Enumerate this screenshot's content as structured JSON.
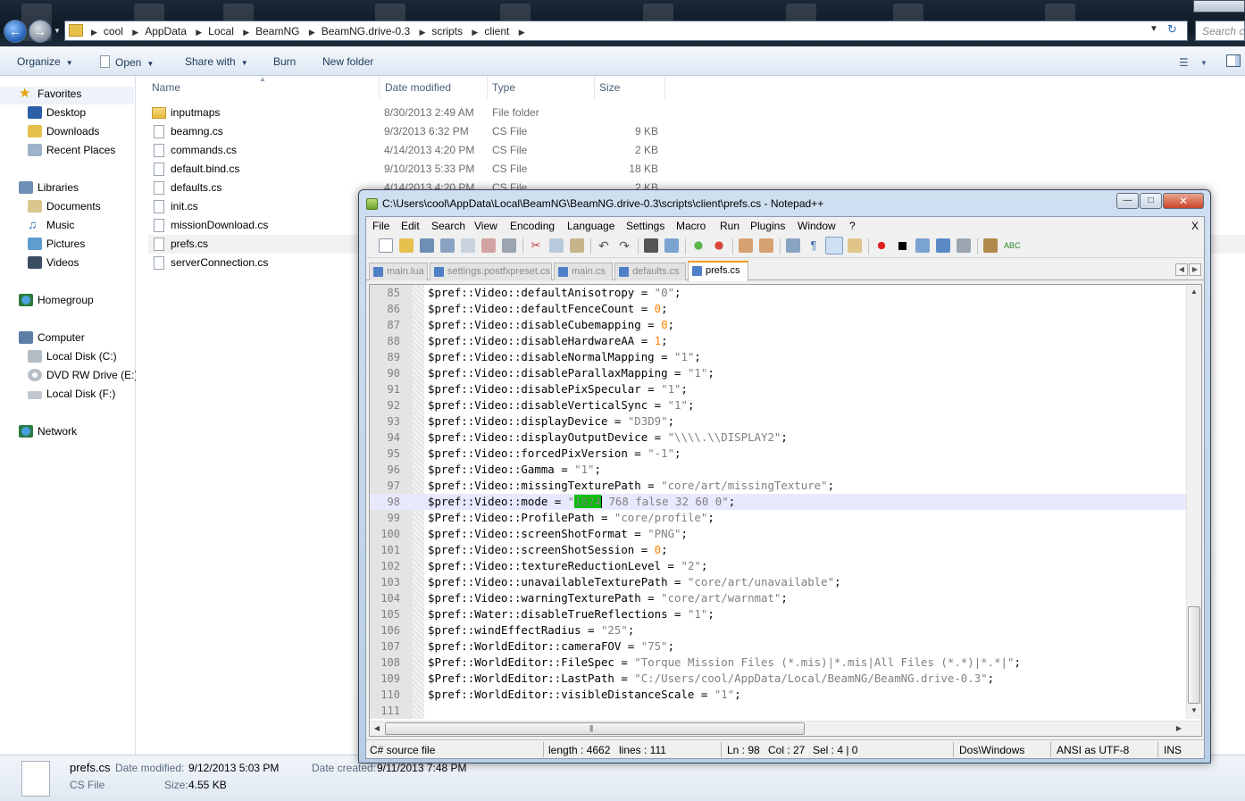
{
  "explorer": {
    "breadcrumbs": [
      "cool",
      "AppData",
      "Local",
      "BeamNG",
      "BeamNG.drive-0.3",
      "scripts",
      "client"
    ],
    "search_placeholder": "Search cl",
    "commands": {
      "organize": "Organize",
      "open": "Open",
      "share_with": "Share with",
      "burn": "Burn",
      "new_folder": "New folder"
    },
    "nav": {
      "favorites": "Favorites",
      "desktop": "Desktop",
      "downloads": "Downloads",
      "recent_places": "Recent Places",
      "libraries": "Libraries",
      "documents": "Documents",
      "music": "Music",
      "pictures": "Pictures",
      "videos": "Videos",
      "homegroup": "Homegroup",
      "computer": "Computer",
      "local_disk_c": "Local Disk (C:)",
      "dvd_drive": "DVD RW Drive (E:)",
      "local_disk_f": "Local Disk (F:)",
      "network": "Network"
    },
    "columns": {
      "name": "Name",
      "date_modified": "Date modified",
      "type": "Type",
      "size": "Size"
    },
    "files": [
      {
        "name": "inputmaps",
        "date": "8/30/2013 2:49 AM",
        "type": "File folder",
        "size": ""
      },
      {
        "name": "beamng.cs",
        "date": "9/3/2013 6:32 PM",
        "type": "CS File",
        "size": "9 KB"
      },
      {
        "name": "commands.cs",
        "date": "4/14/2013 4:20 PM",
        "type": "CS File",
        "size": "2 KB"
      },
      {
        "name": "default.bind.cs",
        "date": "9/10/2013 5:33 PM",
        "type": "CS File",
        "size": "18 KB"
      },
      {
        "name": "defaults.cs",
        "date": "4/14/2013 4:20 PM",
        "type": "CS File",
        "size": "2 KB"
      },
      {
        "name": "init.cs",
        "date": "",
        "type": "",
        "size": ""
      },
      {
        "name": "missionDownload.cs",
        "date": "",
        "type": "",
        "size": ""
      },
      {
        "name": "prefs.cs",
        "date": "",
        "type": "",
        "size": ""
      },
      {
        "name": "serverConnection.cs",
        "date": "",
        "type": "",
        "size": ""
      }
    ],
    "details": {
      "filename": "prefs.cs",
      "filetype": "CS File",
      "date_modified_label": "Date modified:",
      "date_modified": "9/12/2013 5:03 PM",
      "size_label": "Size:",
      "size": "4.55 KB",
      "date_created_label": "Date created:",
      "date_created": "9/11/2013 7:48 PM"
    }
  },
  "notepad": {
    "title": "C:\\Users\\cool\\AppData\\Local\\BeamNG\\BeamNG.drive-0.3\\scripts\\client\\prefs.cs - Notepad++",
    "menu": [
      "File",
      "Edit",
      "Search",
      "View",
      "Encoding",
      "Language",
      "Settings",
      "Macro",
      "Run",
      "Plugins",
      "Window",
      "?"
    ],
    "menu_close": "X",
    "tabs": [
      "main.lua",
      "settings.postfxpreset.cs",
      "main.cs",
      "defaults.cs",
      "prefs.cs"
    ],
    "active_tab": "prefs.cs",
    "lines": [
      {
        "n": "85",
        "var": "$pref::Video::defaultAnisotropy",
        "val": "\"0\"",
        "kind": "str"
      },
      {
        "n": "86",
        "var": "$pref::Video::defaultFenceCount",
        "val": "0",
        "kind": "num"
      },
      {
        "n": "87",
        "var": "$pref::Video::disableCubemapping",
        "val": "0",
        "kind": "num"
      },
      {
        "n": "88",
        "var": "$pref::Video::disableHardwareAA",
        "val": "1",
        "kind": "num"
      },
      {
        "n": "89",
        "var": "$pref::Video::disableNormalMapping",
        "val": "\"1\"",
        "kind": "str"
      },
      {
        "n": "90",
        "var": "$pref::Video::disableParallaxMapping",
        "val": "\"1\"",
        "kind": "str"
      },
      {
        "n": "91",
        "var": "$pref::Video::disablePixSpecular",
        "val": "\"1\"",
        "kind": "str"
      },
      {
        "n": "92",
        "var": "$pref::Video::disableVerticalSync",
        "val": "\"1\"",
        "kind": "str"
      },
      {
        "n": "93",
        "var": "$pref::Video::displayDevice",
        "val": "\"D3D9\"",
        "kind": "str"
      },
      {
        "n": "94",
        "var": "$pref::Video::displayOutputDevice",
        "val": "\"\\\\\\\\.\\\\DISPLAY2\"",
        "kind": "str"
      },
      {
        "n": "95",
        "var": "$pref::Video::forcedPixVersion",
        "val": "\"-1\"",
        "kind": "str"
      },
      {
        "n": "96",
        "var": "$pref::Video::Gamma",
        "val": "\"1\"",
        "kind": "str"
      },
      {
        "n": "97",
        "var": "$pref::Video::missingTexturePath",
        "val": "\"core/art/missingTexture\"",
        "kind": "str"
      },
      {
        "n": "98",
        "var": "$pref::Video::mode",
        "val": "\"1024 768 false 32 60 0\"",
        "kind": "sel",
        "sel": "1024",
        "rest": " 768 false 32 60 0\""
      },
      {
        "n": "99",
        "var": "$Pref::Video::ProfilePath",
        "val": "\"core/profile\"",
        "kind": "str"
      },
      {
        "n": "100",
        "var": "$pref::Video::screenShotFormat",
        "val": "\"PNG\"",
        "kind": "str"
      },
      {
        "n": "101",
        "var": "$pref::Video::screenShotSession",
        "val": "0",
        "kind": "num"
      },
      {
        "n": "102",
        "var": "$pref::Video::textureReductionLevel",
        "val": "\"2\"",
        "kind": "str"
      },
      {
        "n": "103",
        "var": "$pref::Video::unavailableTexturePath",
        "val": "\"core/art/unavailable\"",
        "kind": "str"
      },
      {
        "n": "104",
        "var": "$pref::Video::warningTexturePath",
        "val": "\"core/art/warnmat\"",
        "kind": "str"
      },
      {
        "n": "105",
        "var": "$pref::Water::disableTrueReflections",
        "val": "\"1\"",
        "kind": "str"
      },
      {
        "n": "106",
        "var": "$pref::windEffectRadius",
        "val": "\"25\"",
        "kind": "str"
      },
      {
        "n": "107",
        "var": "$pref::WorldEditor::cameraFOV",
        "val": "\"75\"",
        "kind": "str"
      },
      {
        "n": "108",
        "var": "$Pref::WorldEditor::FileSpec",
        "val": "\"Torque Mission Files (*.mis)|*.mis|All Files (*.*)|*.*|\"",
        "kind": "str"
      },
      {
        "n": "109",
        "var": "$Pref::WorldEditor::LastPath",
        "val": "\"C:/Users/cool/AppData/Local/BeamNG/BeamNG.drive-0.3\"",
        "kind": "str"
      },
      {
        "n": "110",
        "var": "$pref::WorldEditor::visibleDistanceScale",
        "val": "\"1\"",
        "kind": "str"
      },
      {
        "n": "111",
        "var": "",
        "val": "",
        "kind": "empty"
      }
    ],
    "current_line": "98",
    "status": {
      "lang": "C# source file",
      "length": "length : 4662",
      "lines": "lines : 111",
      "ln": "Ln : 98",
      "col": "Col : 27",
      "sel": "Sel : 4 | 0",
      "eol": "Dos\\Windows",
      "encoding": "ANSI as UTF-8",
      "mode": "INS"
    }
  }
}
